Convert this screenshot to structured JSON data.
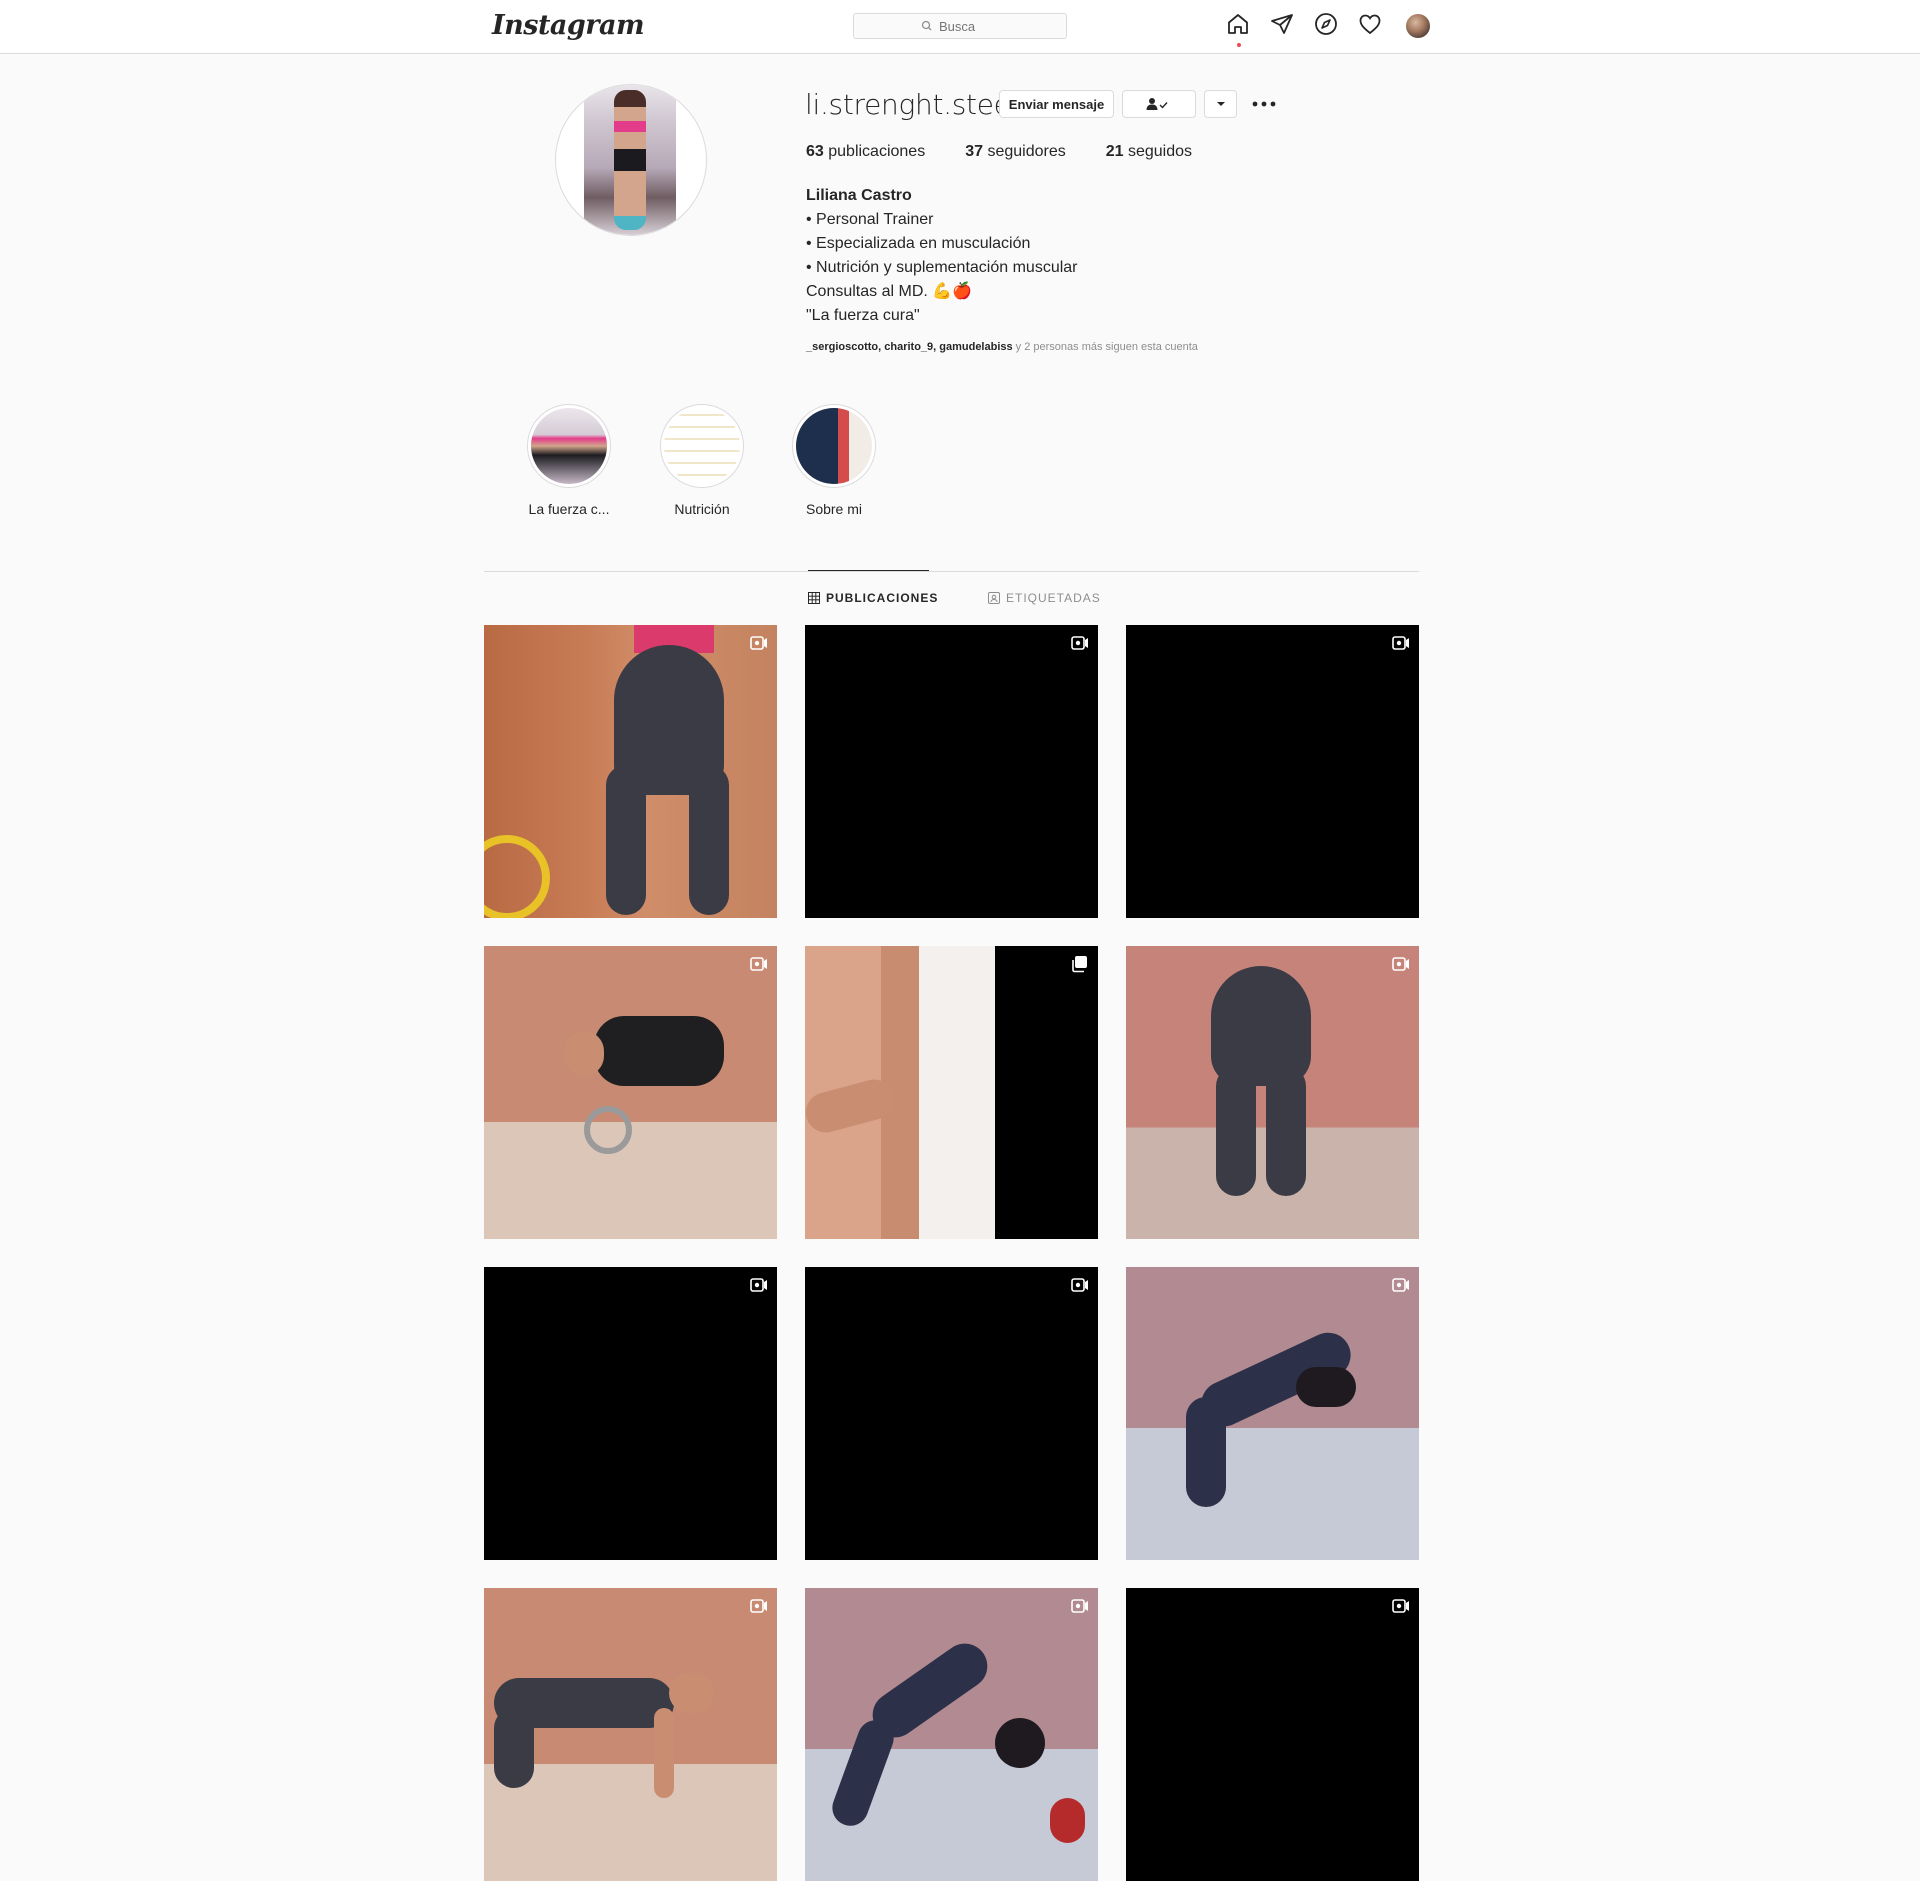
{
  "nav": {
    "logo": "Instagram",
    "search_placeholder": "Busca",
    "icons": [
      "home-icon",
      "direct-icon",
      "explore-icon",
      "activity-icon",
      "profile-avatar"
    ]
  },
  "profile": {
    "username": "li.strenght.steel",
    "message_button": "Enviar mensaje",
    "stats": {
      "posts_count": "63",
      "posts_label": "publicaciones",
      "followers_count": "37",
      "followers_label": "seguidores",
      "following_count": "21",
      "following_label": "seguidos"
    },
    "bio": {
      "full_name": "Liliana Castro",
      "lines": [
        "• Personal Trainer",
        "• Especializada en musculación",
        "• Nutrición y suplementación muscular",
        "Consultas al MD. 💪🍎",
        "\"La fuerza cura\""
      ]
    },
    "followed_by": {
      "names": "_sergioscotto, charito_9, gamudelabiss",
      "suffix": " y 2 personas más siguen esta cuenta"
    }
  },
  "highlights": [
    {
      "label": "La fuerza c..."
    },
    {
      "label": "Nutrición"
    },
    {
      "label": "Sobre mi"
    }
  ],
  "tabs": {
    "posts": "PUBLICACIONES",
    "tagged": "ETIQUETADAS"
  },
  "posts": [
    {
      "kind": "photo-video",
      "badge": "video-icon"
    },
    {
      "kind": "black",
      "badge": "video-icon"
    },
    {
      "kind": "black",
      "badge": "video-icon"
    },
    {
      "kind": "photo-video",
      "badge": "video-icon"
    },
    {
      "kind": "photo-carousel",
      "badge": "carousel-icon"
    },
    {
      "kind": "photo-video",
      "badge": "video-icon"
    },
    {
      "kind": "black",
      "badge": "video-icon"
    },
    {
      "kind": "black",
      "badge": "video-icon"
    },
    {
      "kind": "photo-video",
      "badge": "video-icon"
    },
    {
      "kind": "photo-video",
      "badge": "video-icon"
    },
    {
      "kind": "photo-video",
      "badge": "video-icon"
    },
    {
      "kind": "black",
      "badge": "video-icon"
    }
  ],
  "colors": {
    "background": "#fafafa",
    "border": "#dbdbdb",
    "text": "#262626",
    "secondary_text": "#8e8e8e",
    "notification_dot": "#ed4956"
  }
}
